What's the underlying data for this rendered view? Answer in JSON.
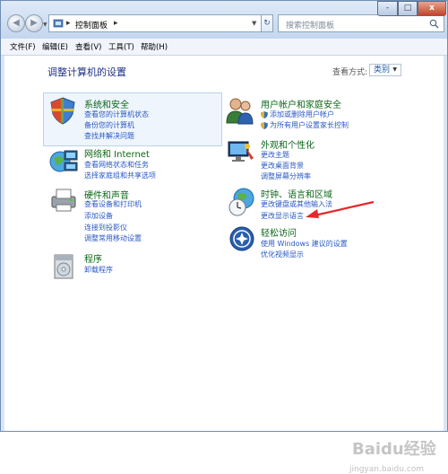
{
  "address": {
    "root_label": "控制面板"
  },
  "search": {
    "placeholder": "搜索控制面板"
  },
  "window_controls": {
    "minimize": "-",
    "maximize": "□",
    "close": "x"
  },
  "menu": [
    "文件(F)",
    "编辑(E)",
    "查看(V)",
    "工具(T)",
    "帮助(H)"
  ],
  "page": {
    "heading": "调整计算机的设置",
    "view_by_label": "查看方式:",
    "view_by_value": "类别"
  },
  "categories": {
    "system": {
      "title": "系统和安全",
      "links": [
        "查看您的计算机状态",
        "备份您的计算机",
        "查找并解决问题"
      ]
    },
    "network": {
      "title": "网络和 Internet",
      "links": [
        "查看网络状态和任务",
        "选择家庭组和共享选项"
      ]
    },
    "hardware": {
      "title": "硬件和声音",
      "links": [
        "查看设备和打印机",
        "添加设备",
        "连接到投影仪",
        "调整常用移动设置"
      ]
    },
    "programs": {
      "title": "程序",
      "links": [
        "卸载程序"
      ]
    },
    "users": {
      "title": "用户帐户和家庭安全",
      "links": [
        "添加或删除用户帐户",
        "为所有用户设置家长控制"
      ]
    },
    "appearance": {
      "title": "外观和个性化",
      "links": [
        "更改主题",
        "更改桌面背景",
        "调整屏幕分辨率"
      ]
    },
    "clock": {
      "title": "时钟、语言和区域",
      "links": [
        "更改键盘或其他输入法",
        "更改显示语言"
      ]
    },
    "ease": {
      "title": "轻松访问",
      "links": [
        "使用 Windows 建议的设置",
        "优化视频显示"
      ]
    }
  },
  "watermark": {
    "main": "Baidu经验",
    "sub": "jingyan.baidu.com"
  },
  "colors": {
    "link": "#2a58c3",
    "category_title": "#0c6718",
    "heading": "#1e3287",
    "annotation_arrow": "#e8262b"
  }
}
